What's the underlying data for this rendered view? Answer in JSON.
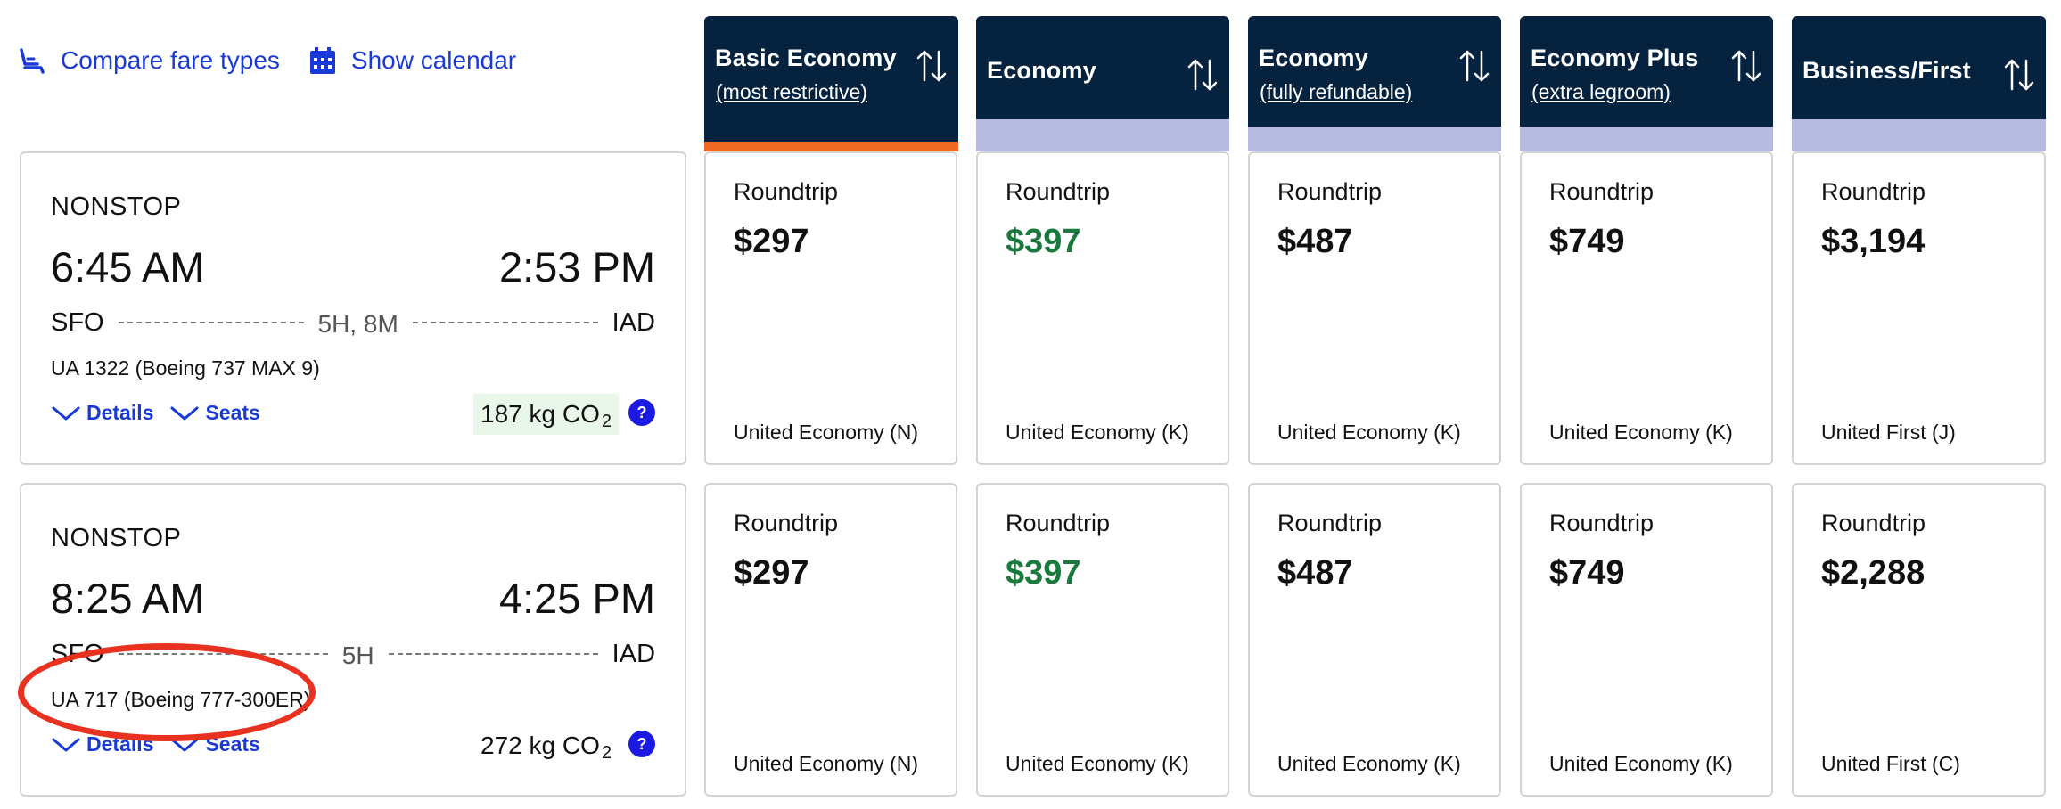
{
  "toolbar": {
    "compare_label": "Compare fare types",
    "calendar_label": "Show calendar"
  },
  "fare_columns": [
    {
      "title": "Basic Economy",
      "subtitle": "(most restrictive)"
    },
    {
      "title": "Economy",
      "subtitle": ""
    },
    {
      "title": "Economy",
      "subtitle": "(fully refundable)"
    },
    {
      "title": "Economy Plus",
      "subtitle": "(extra legroom)"
    },
    {
      "title": "Business/First",
      "subtitle": ""
    }
  ],
  "colors": {
    "accent": "#ee6a25",
    "header_bg": "#05223e",
    "link_blue": "#1a3ad6",
    "price_green": "#1a7a3e",
    "annotation_red": "#e8321f"
  },
  "flights": [
    {
      "stops": "NONSTOP",
      "departure_time": "6:45 AM",
      "arrival_time": "2:53 PM",
      "origin": "SFO",
      "destination": "IAD",
      "duration": "5H, 8M",
      "aircraft": "UA 1322 (Boeing 737 MAX 9)",
      "details_label": "Details",
      "seats_label": "Seats",
      "co2_value": "187 kg CO",
      "co2_sub": "2",
      "info_label": "?",
      "fares": [
        {
          "trip": "Roundtrip",
          "price": "$297",
          "cabin": "United Economy (N)"
        },
        {
          "trip": "Roundtrip",
          "price": "$397",
          "cabin": "United Economy (K)"
        },
        {
          "trip": "Roundtrip",
          "price": "$487",
          "cabin": "United Economy (K)"
        },
        {
          "trip": "Roundtrip",
          "price": "$749",
          "cabin": "United Economy (K)"
        },
        {
          "trip": "Roundtrip",
          "price": "$3,194",
          "cabin": "United First (J)"
        }
      ]
    },
    {
      "stops": "NONSTOP",
      "departure_time": "8:25 AM",
      "arrival_time": "4:25 PM",
      "origin": "SFO",
      "destination": "IAD",
      "duration": "5H",
      "aircraft": "UA 717 (Boeing 777-300ER)",
      "details_label": "Details",
      "seats_label": "Seats",
      "co2_value": "272 kg CO",
      "co2_sub": "2",
      "info_label": "?",
      "fares": [
        {
          "trip": "Roundtrip",
          "price": "$297",
          "cabin": "United Economy (N)"
        },
        {
          "trip": "Roundtrip",
          "price": "$397",
          "cabin": "United Economy (K)"
        },
        {
          "trip": "Roundtrip",
          "price": "$487",
          "cabin": "United Economy (K)"
        },
        {
          "trip": "Roundtrip",
          "price": "$749",
          "cabin": "United Economy (K)"
        },
        {
          "trip": "Roundtrip",
          "price": "$2,288",
          "cabin": "United First (C)"
        }
      ]
    }
  ]
}
